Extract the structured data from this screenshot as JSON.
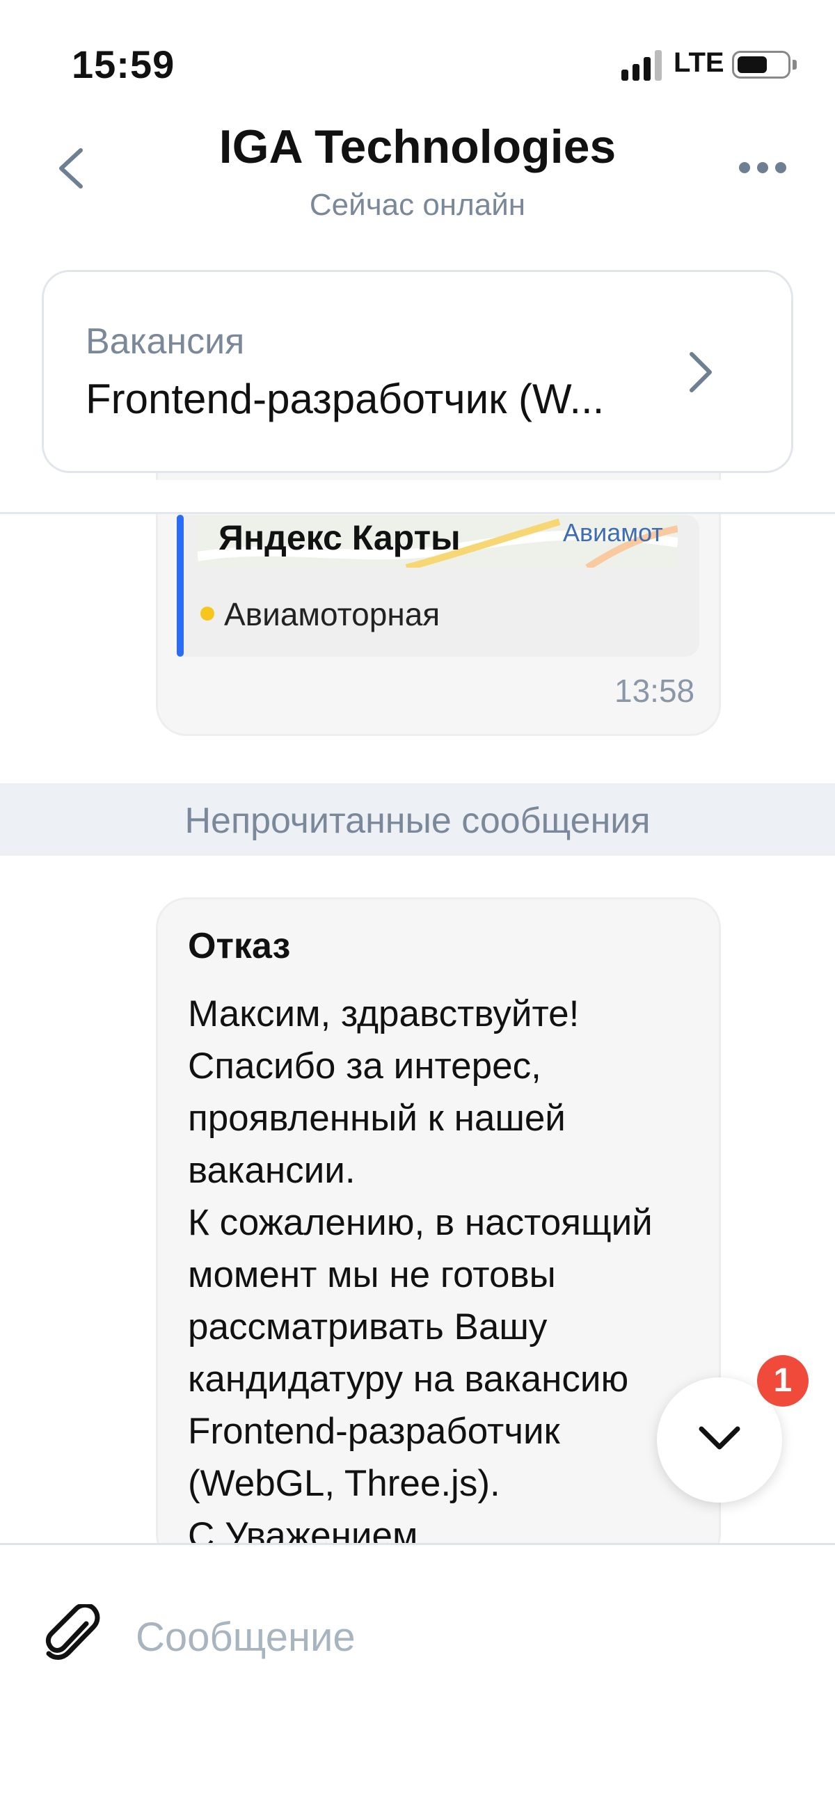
{
  "status_bar": {
    "time": "15:59",
    "network": "LTE"
  },
  "header": {
    "title": "IGA Technologies",
    "subtitle": "Сейчас онлайн"
  },
  "vacancy": {
    "label": "Вакансия",
    "title": "Frontend-разработчик (W..."
  },
  "previous_message": {
    "map_brand": "Яндекс Карты",
    "map_place_label": "Авиамот",
    "metro_station": "Авиамоторная",
    "time": "13:58",
    "colors": {
      "metro_line": "#f6c61c",
      "accent_bar": "#2b6cf6"
    }
  },
  "unread_banner": "Непрочитанные сообщения",
  "message": {
    "title": "Отказ",
    "body": "Максим, здравствуйте!\nСпасибо за интерес,\nпроявленный к нашей\nвакансии.\nК сожалению, в настоящий\nмомент мы не готовы\nрассматривать Вашу\nкандидатуру на вакансию\nFrontend-разработчик\n(WebGL, Three.js).\nС Уважением,"
  },
  "scroll_button": {
    "unread_count": "1",
    "icon": "chevron-down-icon"
  },
  "composer": {
    "placeholder": "Сообщение",
    "attach_icon": "paperclip-icon"
  }
}
